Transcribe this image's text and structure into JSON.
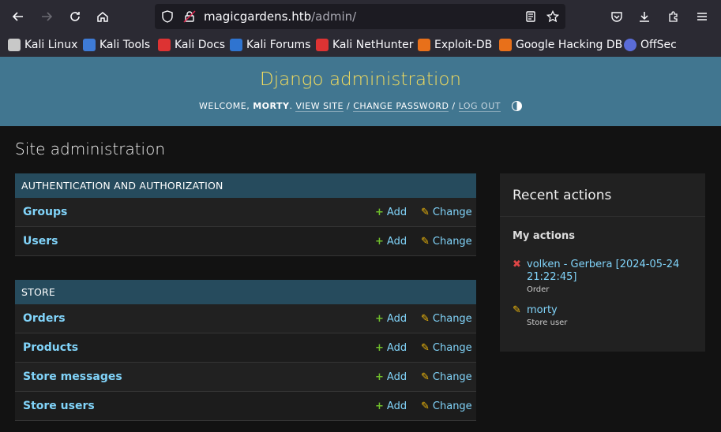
{
  "browser": {
    "url_host": "magicgardens.htb",
    "url_path": "/admin/",
    "bookmarks": [
      {
        "label": "Kali Linux",
        "icon": "kali-dragon-icon",
        "color": "#c8c8c8"
      },
      {
        "label": "Kali Tools",
        "icon": "kali-tools-icon",
        "color": "#3e7bd6"
      },
      {
        "label": "Kali Docs",
        "icon": "kali-docs-icon",
        "color": "#d33"
      },
      {
        "label": "Kali Forums",
        "icon": "kali-forums-icon",
        "color": "#2f74d0"
      },
      {
        "label": "Kali NetHunter",
        "icon": "kali-nethunter-icon",
        "color": "#d33"
      },
      {
        "label": "Exploit-DB",
        "icon": "exploit-db-icon",
        "color": "#e8701a"
      },
      {
        "label": "Google Hacking DB",
        "icon": "ghdb-icon",
        "color": "#e8701a"
      },
      {
        "label": "OffSec",
        "icon": "offsec-icon",
        "color": "#5a6cd8"
      }
    ]
  },
  "header": {
    "title": "Django administration",
    "welcome": "Welcome,",
    "user": "morty",
    "view_site": "View site",
    "change_password": "Change password",
    "log_out": "Log out"
  },
  "page_title": "Site administration",
  "modules": [
    {
      "caption": "Authentication and Authorization",
      "rows": [
        {
          "model": "Groups",
          "add": "Add",
          "change": "Change"
        },
        {
          "model": "Users",
          "add": "Add",
          "change": "Change"
        }
      ]
    },
    {
      "caption": "Store",
      "rows": [
        {
          "model": "Orders",
          "add": "Add",
          "change": "Change"
        },
        {
          "model": "Products",
          "add": "Add",
          "change": "Change"
        },
        {
          "model": "Store messages",
          "add": "Add",
          "change": "Change"
        },
        {
          "model": "Store users",
          "add": "Add",
          "change": "Change"
        }
      ]
    }
  ],
  "recent": {
    "title": "Recent actions",
    "subtitle": "My actions",
    "actions": [
      {
        "text": "volken - Gerbera [2024-05-24 21:22:45]",
        "type": "Order",
        "kind": "delete"
      },
      {
        "text": "morty",
        "type": "Store user",
        "kind": "change"
      }
    ]
  },
  "colors": {
    "header_bg": "#417690",
    "title": "#f5dd5d",
    "caption_bg": "#264b5d",
    "link": "#81d4fa",
    "add_green": "#70bf2b",
    "change_yellow": "#efb80b",
    "delete_red": "#dd4646"
  }
}
